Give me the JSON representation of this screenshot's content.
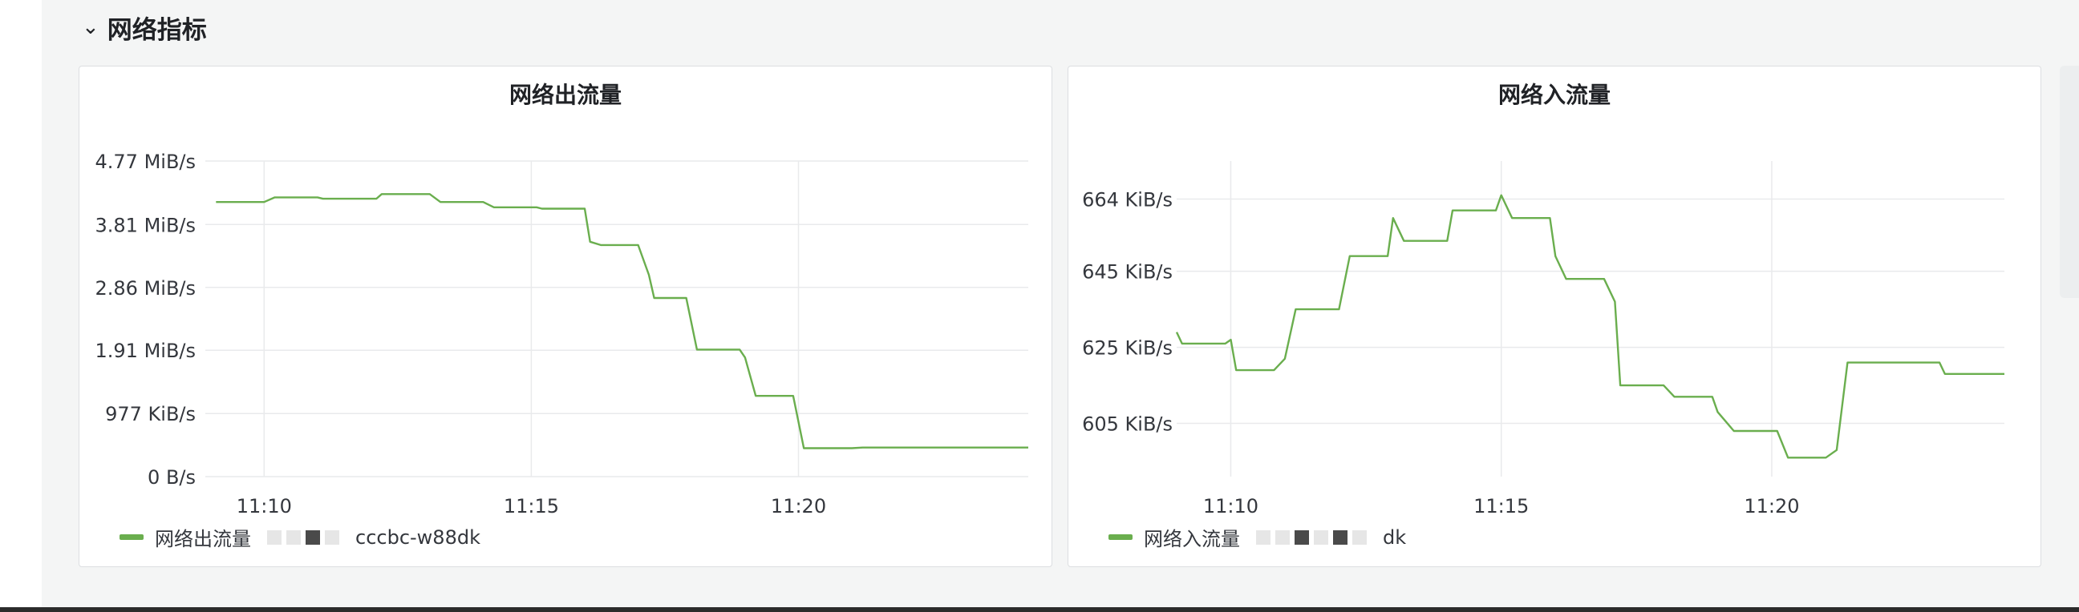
{
  "section": {
    "title": "网络指标",
    "collapse_icon": "chevron-down-icon"
  },
  "colors": {
    "series": "#6aae4e",
    "grid": "#e9eaec"
  },
  "panels": [
    {
      "title": "网络出流量",
      "legend": {
        "prefix": "网络出流量",
        "suffix": "cccbc-w88dk"
      }
    },
    {
      "title": "网络入流量",
      "legend": {
        "prefix": "网络入流量",
        "suffix": "dk"
      }
    }
  ],
  "chart_data": [
    {
      "type": "line",
      "title": "网络出流量",
      "y_unit": "MiB/s",
      "y_ticks": [
        "0 B/s",
        "977 KiB/s",
        "1.91 MiB/s",
        "2.86 MiB/s",
        "3.81 MiB/s",
        "4.77 MiB/s"
      ],
      "y_tick_values": [
        0,
        0.954,
        1.91,
        2.86,
        3.81,
        4.77
      ],
      "ylim": [
        0,
        4.77
      ],
      "x_ticks": [
        "11:10",
        "11:15",
        "11:20"
      ],
      "x_tick_values": [
        670,
        675,
        680
      ],
      "xlim": [
        668.9,
        684.3
      ],
      "grid": true,
      "legend_position": "bottom-left",
      "series": [
        {
          "x": [
            669.1,
            670.0,
            670.2,
            671.0,
            671.1,
            672.1,
            672.2,
            673.1,
            673.3,
            674.1,
            674.3,
            675.1,
            675.2,
            676.0,
            676.1,
            676.3,
            677.0,
            677.2,
            677.3,
            677.9,
            678.1,
            678.9,
            679.0,
            679.2,
            679.9,
            680.1,
            681.0,
            681.2,
            684.3
          ],
          "y": [
            4.15,
            4.15,
            4.22,
            4.22,
            4.2,
            4.2,
            4.27,
            4.27,
            4.15,
            4.15,
            4.07,
            4.07,
            4.05,
            4.05,
            3.55,
            3.5,
            3.5,
            3.05,
            2.7,
            2.7,
            1.92,
            1.92,
            1.8,
            1.22,
            1.22,
            0.43,
            0.43,
            0.44,
            0.44
          ]
        }
      ]
    },
    {
      "type": "line",
      "title": "网络入流量",
      "y_unit": "KiB/s",
      "y_ticks": [
        "605 KiB/s",
        "625 KiB/s",
        "645 KiB/s",
        "664 KiB/s"
      ],
      "y_tick_values": [
        605,
        625,
        645,
        664
      ],
      "ylim": [
        591,
        674
      ],
      "x_ticks": [
        "11:10",
        "11:15",
        "11:20"
      ],
      "x_tick_values": [
        670,
        675,
        680
      ],
      "xlim": [
        669.0,
        684.3
      ],
      "grid": true,
      "legend_position": "bottom-left",
      "series": [
        {
          "x": [
            669.0,
            669.1,
            669.9,
            670.0,
            670.1,
            670.8,
            671.0,
            671.2,
            672.0,
            672.2,
            672.9,
            673.0,
            673.2,
            674.0,
            674.1,
            674.9,
            675.0,
            675.2,
            675.9,
            676.0,
            676.2,
            676.9,
            677.1,
            677.2,
            678.0,
            678.2,
            678.9,
            679.0,
            679.3,
            680.1,
            680.3,
            681.0,
            681.2,
            681.4,
            682.2,
            683.1,
            683.2,
            684.3
          ],
          "y": [
            629,
            626,
            626,
            627,
            619,
            619,
            622,
            635,
            635,
            649,
            649,
            659,
            653,
            653,
            661,
            661,
            665,
            659,
            659,
            649,
            643,
            643,
            637,
            615,
            615,
            612,
            612,
            608,
            603,
            603,
            596,
            596,
            598,
            621,
            621,
            621,
            618,
            618
          ]
        }
      ]
    }
  ]
}
